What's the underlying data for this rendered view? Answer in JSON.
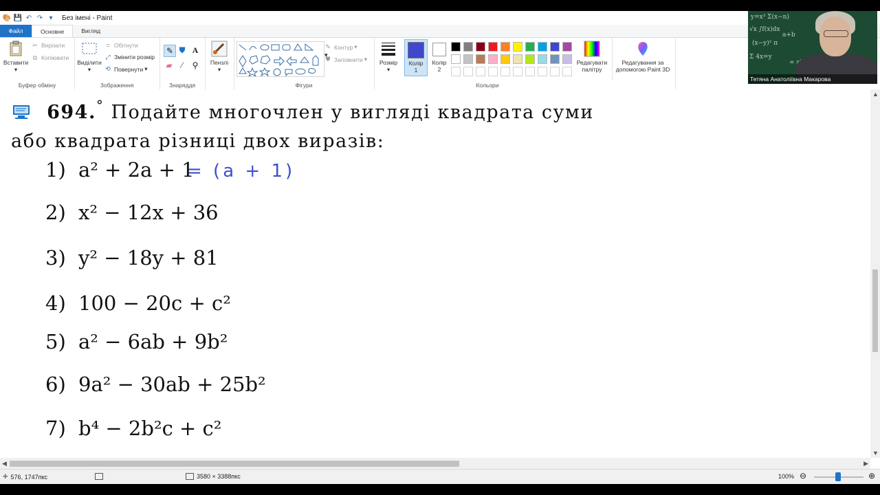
{
  "window": {
    "title": "Без імені - Paint"
  },
  "tabs": [
    {
      "label": "Файл"
    },
    {
      "label": "Основне"
    },
    {
      "label": "Вигляд"
    }
  ],
  "ribbon": {
    "clipboard": {
      "group_label": "Буфер обміну",
      "paste_label": "Вставити",
      "cut_label": "Вирізати",
      "copy_label": "Копіювати"
    },
    "image": {
      "group_label": "Зображення",
      "select_label": "Виділити",
      "crop_label": "Обітнути",
      "resize_label": "Змінити розмір",
      "rotate_label": "Повернути"
    },
    "tools": {
      "group_label": "Знаряддя"
    },
    "brushes": {
      "label": "Пензлі"
    },
    "shapes": {
      "group_label": "Фігури",
      "outline_label": "Контур",
      "fill_label": "Заповнити"
    },
    "size": {
      "label": "Розмір"
    },
    "colors": {
      "group_label": "Кольори",
      "color1_label": "Колір",
      "color1_num": "1",
      "color2_label": "Колір",
      "color2_num": "2",
      "color1_value": "#3f48cc",
      "color2_value": "#ffffff",
      "palette_row1": [
        "#000000",
        "#7f7f7f",
        "#880015",
        "#ed1c24",
        "#ff7f27",
        "#fff200",
        "#22b14c",
        "#00a2e8",
        "#3f48cc",
        "#a349a4"
      ],
      "palette_row2": [
        "#ffffff",
        "#c3c3c3",
        "#b97a57",
        "#ffaec9",
        "#ffc90e",
        "#efe4b0",
        "#b5e61d",
        "#99d9ea",
        "#7092be",
        "#c8bfe7"
      ],
      "edit_colors_line1": "Редагувати",
      "edit_colors_line2": "палітру",
      "paint3d_line1": "Редагування за",
      "paint3d_line2": "допомогою Paint 3D"
    }
  },
  "video": {
    "participant_name": "Тетяна Анатоліївна Макарова"
  },
  "document": {
    "task_number": "694.",
    "degree_mark": "°",
    "heading_line1": "Подайте многочлен у вигляді квадрата суми",
    "heading_line2": "або квадрата різниці двох виразів:",
    "exercises": [
      {
        "label": "1)",
        "expr": "a² + 2a + 1"
      },
      {
        "label": "2)",
        "expr": "x² − 12x + 36"
      },
      {
        "label": "3)",
        "expr": "y² − 18y + 81"
      },
      {
        "label": "4)",
        "expr": "100 − 20c + c²"
      },
      {
        "label": "5)",
        "expr": "a² − 6ab + 9b²"
      },
      {
        "label": "6)",
        "expr": "9a² − 30ab + 25b²"
      },
      {
        "label": "7)",
        "expr": "b⁴ − 2b²c + c²"
      }
    ],
    "handwritten_answer": "= (a + 1)"
  },
  "statusbar": {
    "cursor_position": "576, 1747пкс",
    "image_size": "3580 × 3388пкс",
    "zoom": "100%"
  }
}
